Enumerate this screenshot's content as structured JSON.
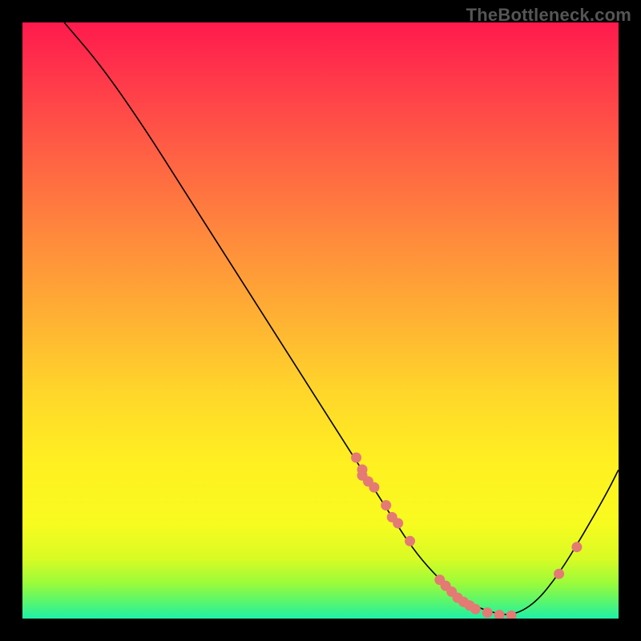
{
  "watermark": "TheBottleneck.com",
  "colors": {
    "dot": "#e47a74",
    "curve": "#000000",
    "frame_bg_top": "#ff1a4d",
    "frame_bg_bottom": "#1ef0a7",
    "page_bg": "#000000"
  },
  "chart_data": {
    "type": "line",
    "title": "",
    "xlabel": "",
    "ylabel": "",
    "xlim": [
      0,
      100
    ],
    "ylim": [
      0,
      100
    ],
    "grid": false,
    "series": [
      {
        "name": "curve",
        "x": [
          7,
          13,
          20,
          27,
          34,
          41,
          48,
          55,
          62,
          66,
          70,
          74,
          78,
          82,
          86,
          90,
          94,
          98,
          100
        ],
        "y": [
          100,
          93,
          83,
          72,
          61,
          50,
          39,
          28,
          17,
          11,
          6.5,
          3.0,
          1.2,
          0.4,
          2.5,
          7.5,
          14,
          21,
          25
        ]
      }
    ],
    "scatter": {
      "name": "dots",
      "x": [
        56,
        57,
        57,
        58,
        59,
        61,
        62,
        63,
        65,
        70,
        71,
        72,
        73,
        74,
        75,
        76,
        78,
        80,
        82,
        90,
        93
      ],
      "y": [
        27,
        25,
        24,
        23,
        22,
        19,
        17,
        16,
        13,
        6.5,
        5.5,
        4.5,
        3.5,
        2.8,
        2.2,
        1.6,
        1.0,
        0.6,
        0.5,
        7.5,
        12
      ],
      "r": [
        6,
        6,
        6,
        6,
        6,
        6,
        6,
        6,
        6,
        6,
        6,
        6,
        6,
        6,
        6,
        6,
        6,
        6,
        6,
        6,
        6
      ]
    }
  }
}
